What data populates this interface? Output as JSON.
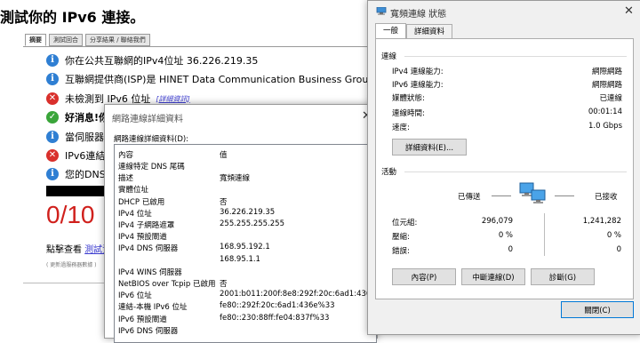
{
  "web": {
    "title": "測試你的 IPv6 連接。",
    "tabs": [
      "摘要",
      "測試回合",
      "分享結果 / 聯絡我們"
    ],
    "rows": [
      {
        "icon": "info",
        "text": "你在公共互聯網的IPv4位址 36.226.219.35"
      },
      {
        "icon": "info",
        "text": "互聯網提供商(ISP)是 HINET Data Communication Business Group, TW"
      },
      {
        "icon": "err",
        "text": "未檢測到 IPv6 位址",
        "link": "[詳細資訊]"
      },
      {
        "icon": "ok",
        "text": "好消息!你"
      },
      {
        "icon": "info",
        "text": "當伺服器"
      },
      {
        "icon": "err",
        "text": "IPv6連結"
      },
      {
        "icon": "info",
        "text": "您的DNS"
      }
    ],
    "score": "0/10",
    "footer_prefix": "點擊查看",
    "footer_link": "測試資料",
    "footnote": "( 更新過服務器數據 )"
  },
  "details": {
    "title": "網路連線詳細資料",
    "heading": "網路連線詳細資料(D):",
    "col_property": "內容",
    "col_value": "值",
    "rows": [
      {
        "k": "連線特定 DNS 尾碼",
        "v": ""
      },
      {
        "k": "描述",
        "v": "寬頻連線"
      },
      {
        "k": "實體位址",
        "v": ""
      },
      {
        "k": "DHCP 已啟用",
        "v": "否"
      },
      {
        "k": "IPv4 位址",
        "v": "36.226.219.35"
      },
      {
        "k": "IPv4 子網路遮罩",
        "v": "255.255.255.255"
      },
      {
        "k": "IPv4 預設閘道",
        "v": ""
      },
      {
        "k": "IPv4 DNS 伺服器",
        "v": "168.95.192.1"
      },
      {
        "k": "",
        "v": "168.95.1.1"
      },
      {
        "k": "IPv4 WINS 伺服器",
        "v": ""
      },
      {
        "k": "NetBIOS over Tcpip 已啟用",
        "v": "否"
      },
      {
        "k": "IPv6 位址",
        "v": "2001:b011:200f:8e8:292f:20c:6ad1:436e"
      },
      {
        "k": "連結-本機 IPv6 位址",
        "v": "fe80::292f:20c:6ad1:436e%33"
      },
      {
        "k": "IPv6 預設閘道",
        "v": "fe80::230:88ff:fe04:837f%33"
      },
      {
        "k": "IPv6 DNS 伺服器",
        "v": ""
      }
    ]
  },
  "status": {
    "title": "寬頻連線 狀態",
    "tabs": [
      "一般",
      "詳細資料"
    ],
    "connection_header": "連線",
    "ipv4_label": "IPv4 連線能力:",
    "ipv4_value": "網際網路",
    "ipv6_label": "IPv6 連線能力:",
    "ipv6_value": "網際網路",
    "media_label": "媒體狀態:",
    "media_value": "已連線",
    "duration_label": "連線時間:",
    "duration_value": "00:01:14",
    "speed_label": "速度:",
    "speed_value": "1.0 Gbps",
    "details_button": "詳細資料(E)...",
    "activity_header": "活動",
    "sent_label": "已傳送",
    "received_label": "已接收",
    "bytes_label": "位元組:",
    "bytes_sent": "296,079",
    "bytes_received": "1,241,282",
    "compression_label": "壓縮:",
    "compression_sent": "0 %",
    "compression_received": "0 %",
    "errors_label": "錯誤:",
    "errors_sent": "0",
    "errors_received": "0",
    "properties_button": "內容(P)",
    "disconnect_button": "中斷連線(D)",
    "diagnose_button": "診斷(G)",
    "close_button": "關閉(C)"
  }
}
